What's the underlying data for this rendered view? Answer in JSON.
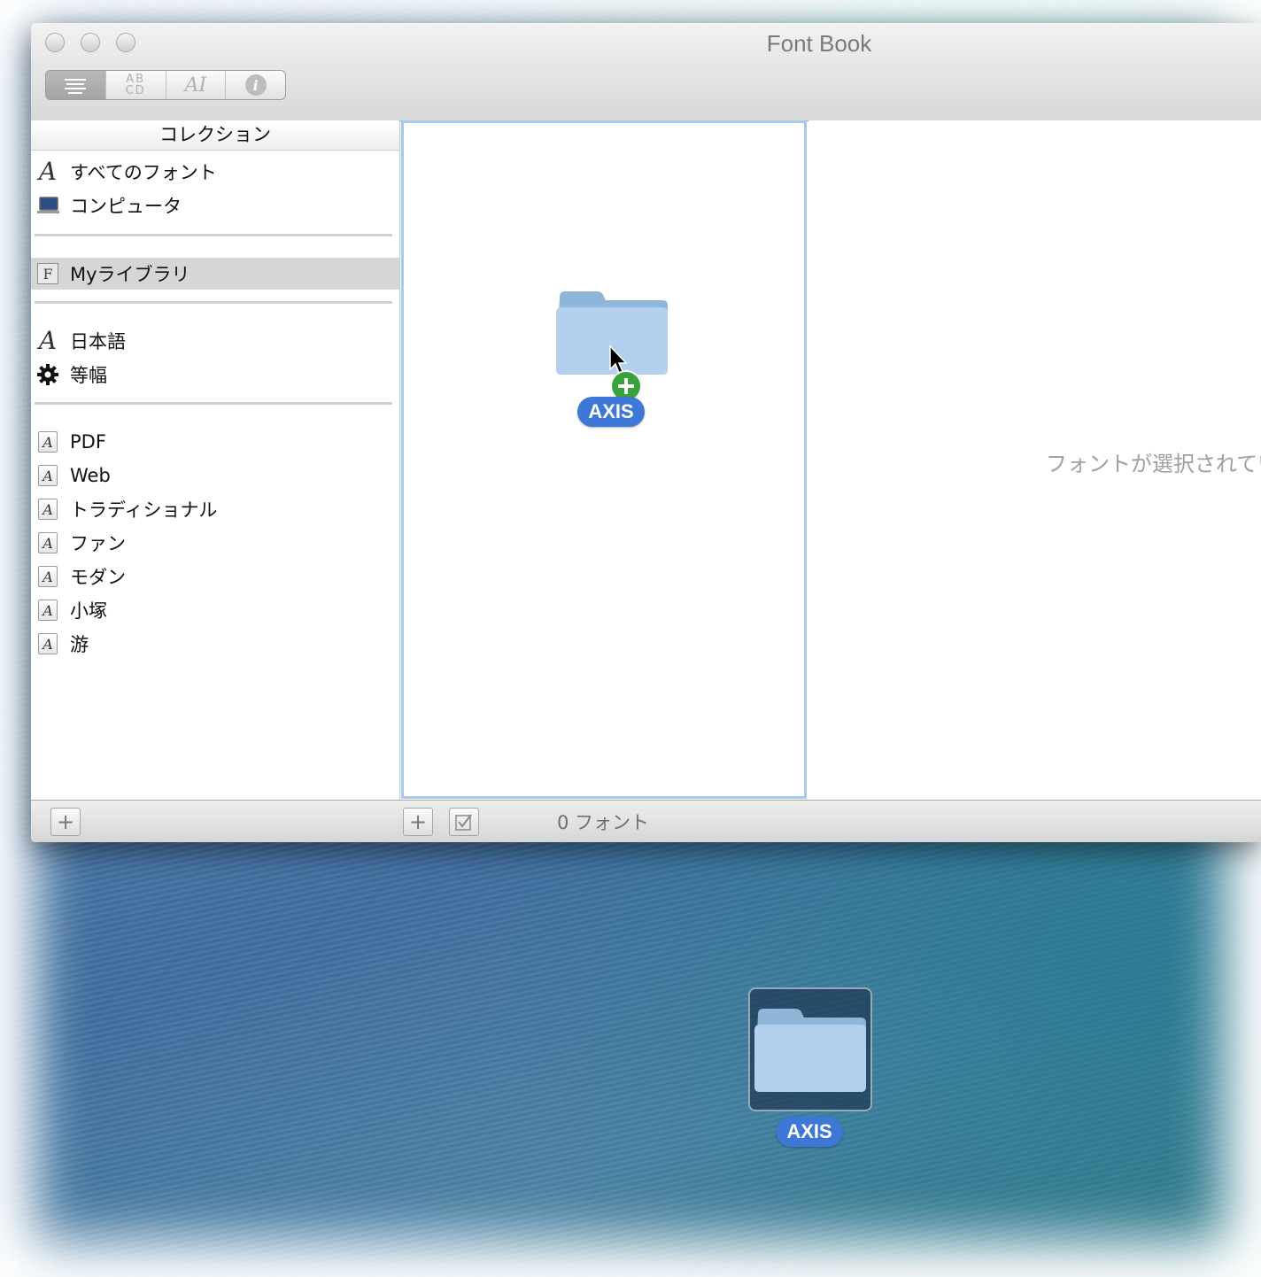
{
  "window": {
    "title": "Font Book",
    "toolbar_segments": [
      {
        "name": "list-view",
        "label": ""
      },
      {
        "name": "sample-view",
        "label": "AB CD"
      },
      {
        "name": "custom-view",
        "label": "AI"
      },
      {
        "name": "info-view",
        "label": "i"
      }
    ]
  },
  "sidebar": {
    "header": "コレクション",
    "groups": [
      {
        "label": "すべてのフォント",
        "icon": "script-a-icon"
      },
      {
        "label": "コンピュータ",
        "icon": "laptop-icon"
      },
      {
        "label": "Myライブラリ",
        "icon": "library-f-icon",
        "selected": true
      },
      {
        "label": "日本語",
        "icon": "script-a-icon"
      },
      {
        "label": "等幅",
        "icon": "gear-icon"
      },
      {
        "label": "PDF",
        "icon": "collection-doc-icon"
      },
      {
        "label": "Web",
        "icon": "collection-doc-icon"
      },
      {
        "label": "トラディショナル",
        "icon": "collection-doc-icon"
      },
      {
        "label": "ファン",
        "icon": "collection-doc-icon"
      },
      {
        "label": "モダン",
        "icon": "collection-doc-icon"
      },
      {
        "label": "小塚",
        "icon": "collection-doc-icon"
      },
      {
        "label": "游",
        "icon": "collection-doc-icon"
      }
    ]
  },
  "font_list": {
    "dragged_folder_label": "AXIS",
    "count_text": "0 フォント"
  },
  "preview": {
    "placeholder": "フォントが選択されていません"
  },
  "desktop": {
    "folder_label": "AXIS"
  },
  "colors": {
    "accent": "#3e78d6",
    "selection": "#d6d6d6",
    "focus_ring": "#a9c8ef",
    "copy_badge": "#3aa23a"
  }
}
